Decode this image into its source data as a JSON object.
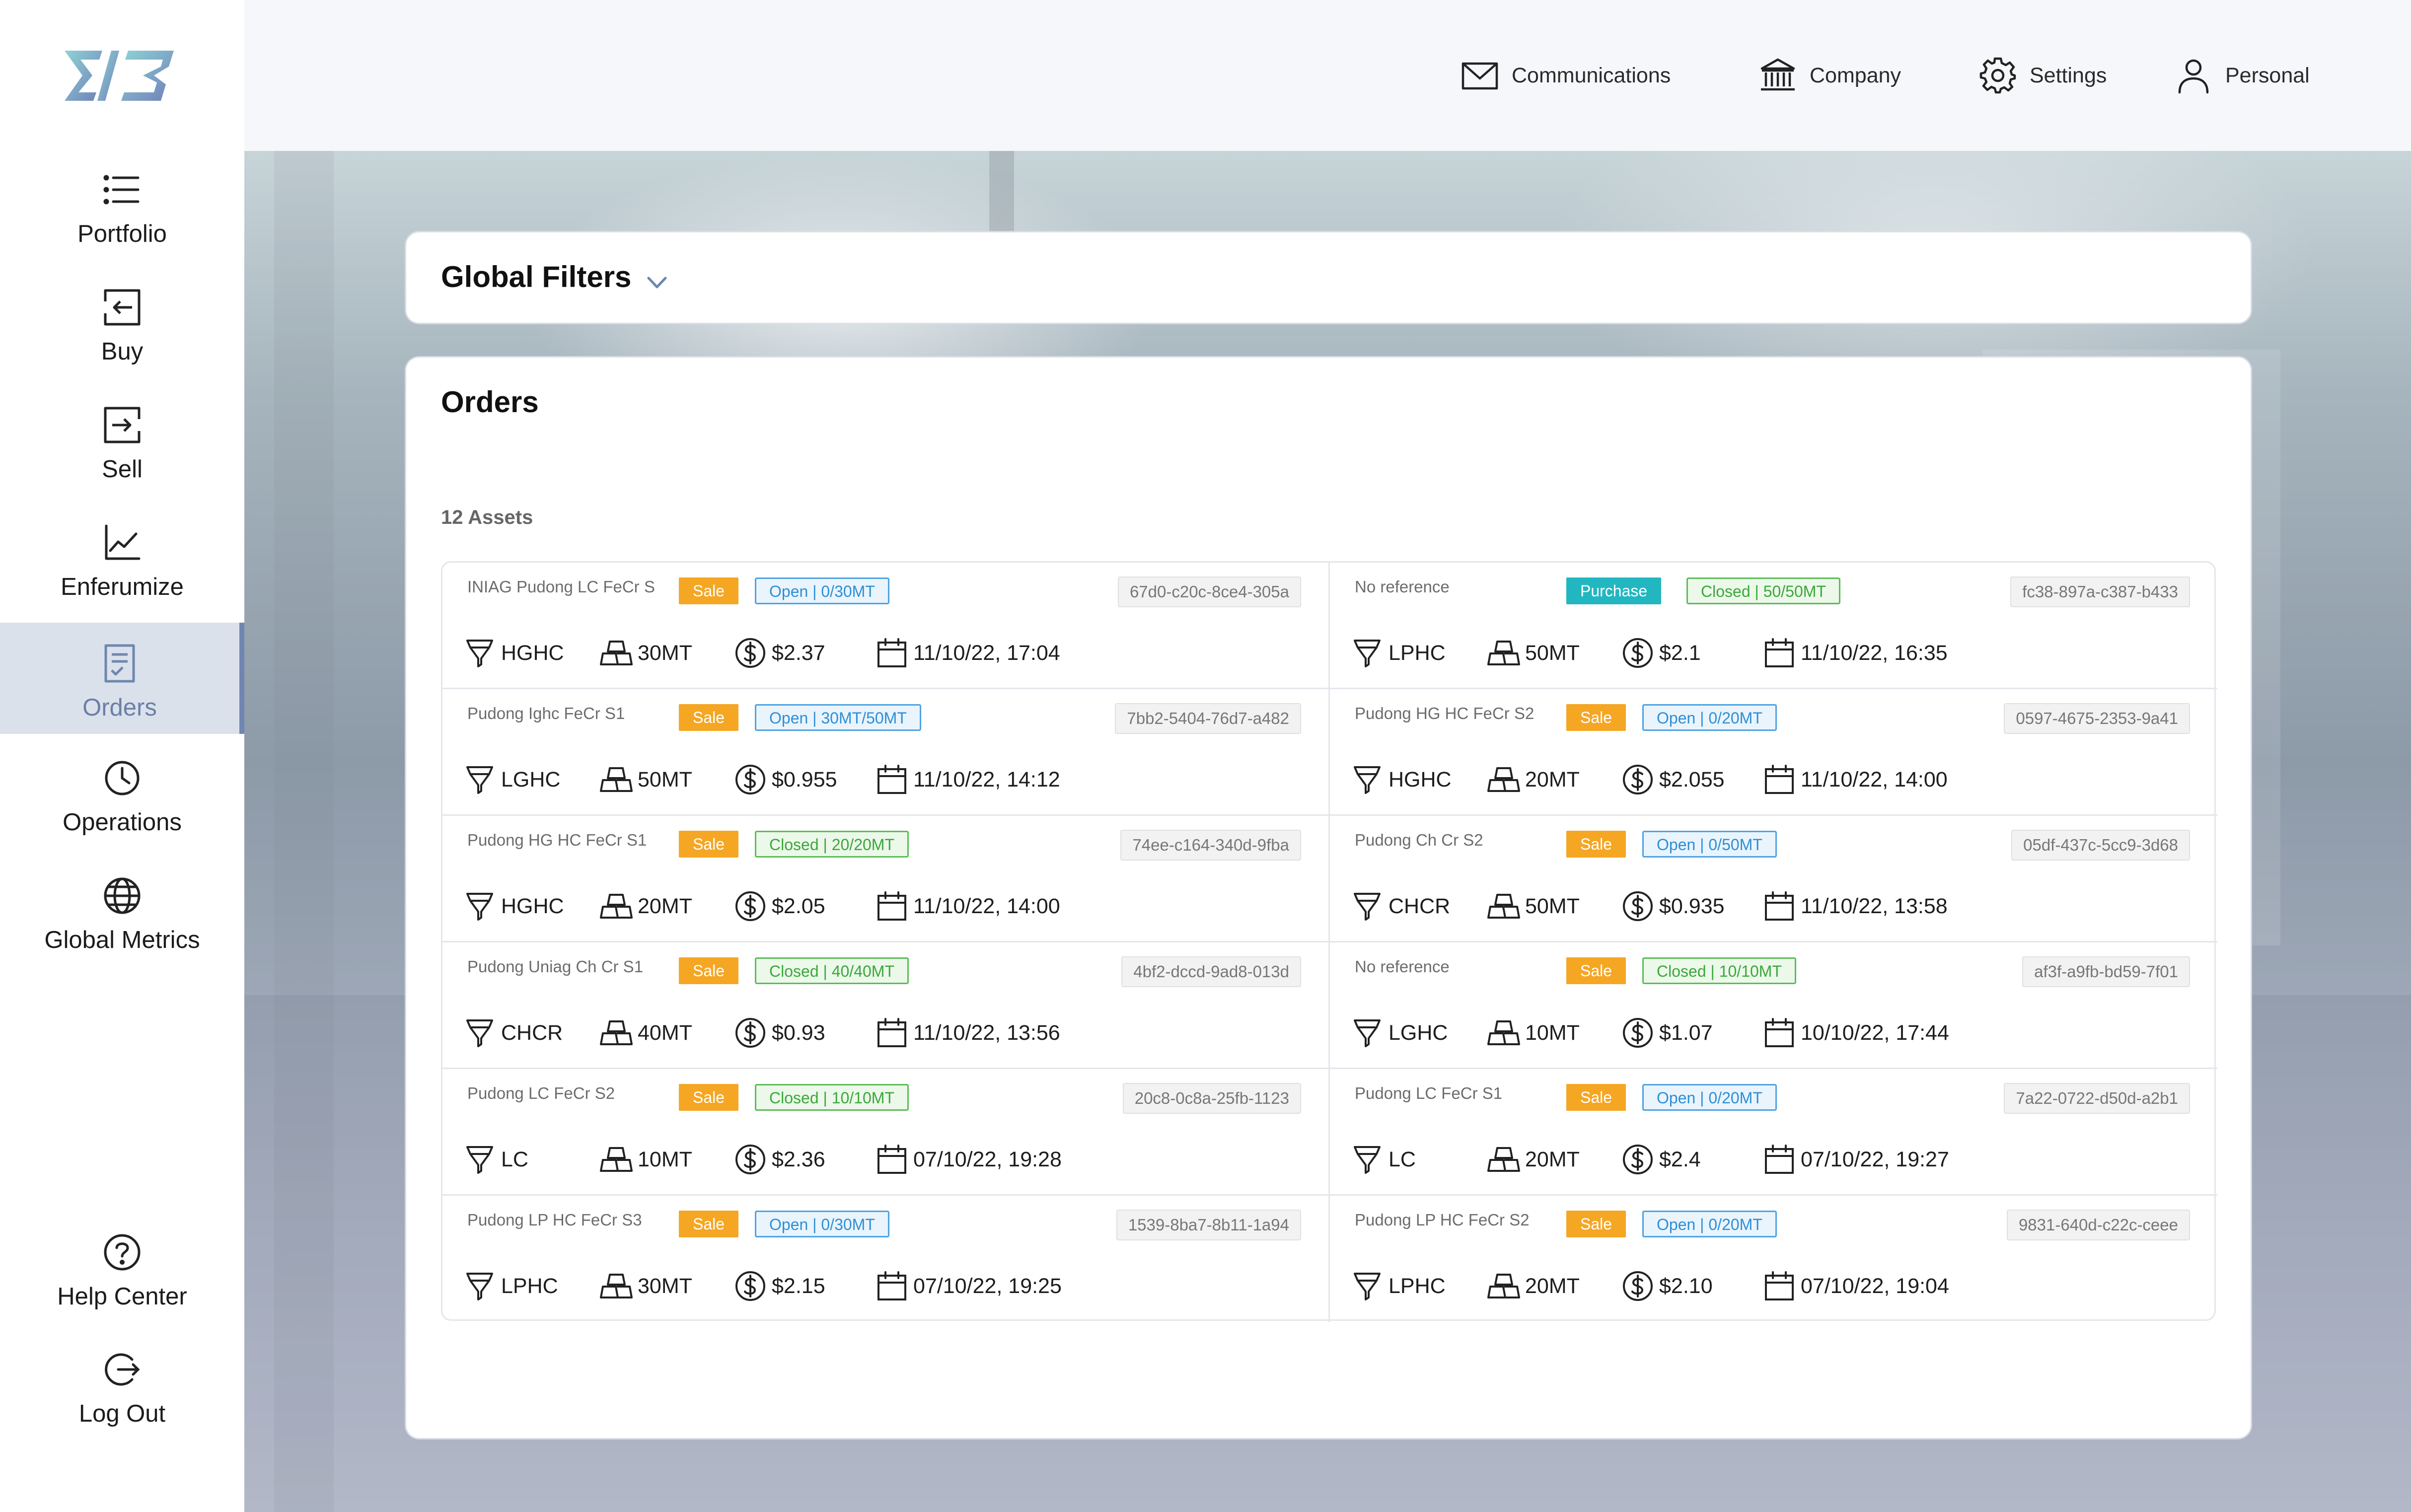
{
  "sidebar": {
    "logo_alt": "Enferum logo",
    "items": [
      {
        "label": "Portfolio",
        "icon": "list-icon"
      },
      {
        "label": "Buy",
        "icon": "buy-arrow-in-icon"
      },
      {
        "label": "Sell",
        "icon": "sell-arrow-out-icon"
      },
      {
        "label": "Enferumize",
        "icon": "line-chart-icon"
      },
      {
        "label": "Orders",
        "icon": "orders-document-icon",
        "active": true
      },
      {
        "label": "Operations",
        "icon": "clock-icon"
      },
      {
        "label": "Global Metrics",
        "icon": "globe-icon"
      }
    ],
    "bottom_items": [
      {
        "label": "Help Center",
        "icon": "help-circle-icon"
      },
      {
        "label": "Log Out",
        "icon": "logout-icon"
      }
    ]
  },
  "header": {
    "links": [
      {
        "label": "Communications",
        "icon": "envelope-icon"
      },
      {
        "label": "Company",
        "icon": "bank-building-icon"
      },
      {
        "label": "Settings",
        "icon": "gear-icon"
      },
      {
        "label": "Personal",
        "icon": "user-icon"
      }
    ]
  },
  "filters": {
    "title": "Global Filters"
  },
  "orders": {
    "title": "Orders",
    "asset_count": "12 Assets",
    "items": [
      {
        "reference": "INIAG Pudong LC FeCr S",
        "type": "Sale",
        "status": "Open | 0/30MT",
        "status_kind": "open",
        "id": "67d0-c20c-8ce4-305a",
        "grade": "HGHC",
        "quantity": "30MT",
        "price": "$2.37",
        "date": "11/10/22, 17:04"
      },
      {
        "reference": "No reference",
        "type": "Purchase",
        "status": "Closed | 50/50MT",
        "status_kind": "closed",
        "id": "fc38-897a-c387-b433",
        "grade": "LPHC",
        "quantity": "50MT",
        "price": "$2.1",
        "date": "11/10/22, 16:35"
      },
      {
        "reference": "Pudong Ighc FeCr S1",
        "type": "Sale",
        "status": "Open | 30MT/50MT",
        "status_kind": "open",
        "id": "7bb2-5404-76d7-a482",
        "grade": "LGHC",
        "quantity": "50MT",
        "price": "$0.955",
        "date": "11/10/22, 14:12"
      },
      {
        "reference": "Pudong HG HC FeCr S2",
        "type": "Sale",
        "status": "Open | 0/20MT",
        "status_kind": "open",
        "id": "0597-4675-2353-9a41",
        "grade": "HGHC",
        "quantity": "20MT",
        "price": "$2.055",
        "date": "11/10/22, 14:00"
      },
      {
        "reference": "Pudong HG HC FeCr S1",
        "type": "Sale",
        "status": "Closed | 20/20MT",
        "status_kind": "closed",
        "id": "74ee-c164-340d-9fba",
        "grade": "HGHC",
        "quantity": "20MT",
        "price": "$2.05",
        "date": "11/10/22, 14:00"
      },
      {
        "reference": "Pudong Ch Cr S2",
        "type": "Sale",
        "status": "Open | 0/50MT",
        "status_kind": "open",
        "id": "05df-437c-5cc9-3d68",
        "grade": "CHCR",
        "quantity": "50MT",
        "price": "$0.935",
        "date": "11/10/22, 13:58"
      },
      {
        "reference": "Pudong Uniag Ch Cr S1",
        "type": "Sale",
        "status": "Closed | 40/40MT",
        "status_kind": "closed",
        "id": "4bf2-dccd-9ad8-013d",
        "grade": "CHCR",
        "quantity": "40MT",
        "price": "$0.93",
        "date": "11/10/22, 13:56"
      },
      {
        "reference": "No reference",
        "type": "Sale",
        "status": "Closed | 10/10MT",
        "status_kind": "closed",
        "id": "af3f-a9fb-bd59-7f01",
        "grade": "LGHC",
        "quantity": "10MT",
        "price": "$1.07",
        "date": "10/10/22, 17:44"
      },
      {
        "reference": "Pudong LC FeCr S2",
        "type": "Sale",
        "status": "Closed | 10/10MT",
        "status_kind": "closed",
        "id": "20c8-0c8a-25fb-1123",
        "grade": "LC",
        "quantity": "10MT",
        "price": "$2.36",
        "date": "07/10/22, 19:28"
      },
      {
        "reference": "Pudong LC FeCr S1",
        "type": "Sale",
        "status": "Open | 0/20MT",
        "status_kind": "open",
        "id": "7a22-0722-d50d-a2b1",
        "grade": "LC",
        "quantity": "20MT",
        "price": "$2.4",
        "date": "07/10/22, 19:27"
      },
      {
        "reference": "Pudong LP HC FeCr S3",
        "type": "Sale",
        "status": "Open | 0/30MT",
        "status_kind": "open",
        "id": "1539-8ba7-8b11-1a94",
        "grade": "LPHC",
        "quantity": "30MT",
        "price": "$2.15",
        "date": "07/10/22, 19:25"
      },
      {
        "reference": "Pudong LP HC FeCr S2",
        "type": "Sale",
        "status": "Open | 0/20MT",
        "status_kind": "open",
        "id": "9831-640d-c22c-ceee",
        "grade": "LPHC",
        "quantity": "20MT",
        "price": "$2.10",
        "date": "07/10/22, 19:04"
      }
    ]
  },
  "colors": {
    "sale": "#f5a623",
    "purchase": "#22b7c0",
    "open": "#4ea3e2",
    "closed": "#5cbd58",
    "nav_active": "#6f86b0"
  }
}
